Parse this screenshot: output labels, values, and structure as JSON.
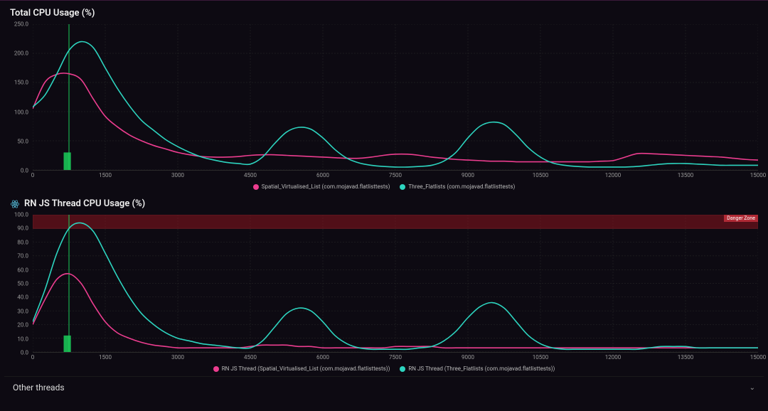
{
  "panels": {
    "total": {
      "title": "Total CPU Usage (%)"
    },
    "rnjs": {
      "title": "RN JS Thread CPU Usage (%)",
      "danger_label": "Danger Zone"
    },
    "other": {
      "title": "Other threads"
    }
  },
  "colors": {
    "series_a": "#ec3d8f",
    "series_b": "#2dd4bf",
    "danger_fill": "rgba(150,20,30,0.5)",
    "marker_green": "#1bcf5a"
  },
  "chart_data": [
    {
      "id": "total_cpu",
      "type": "line",
      "title": "Total CPU Usage (%)",
      "xlabel": "",
      "ylabel": "",
      "xlim": [
        0,
        15000
      ],
      "ylim": [
        0,
        250
      ],
      "x_ticks": [
        0,
        1500,
        3000,
        4500,
        6000,
        7500,
        9000,
        10500,
        12000,
        13500,
        15000
      ],
      "y_ticks": [
        0,
        50,
        100,
        150,
        200,
        250
      ],
      "y_tick_labels": [
        "0.0",
        "50.0",
        "100.0",
        "150.0",
        "200.0",
        "250.0"
      ],
      "x": [
        0,
        250,
        500,
        750,
        1000,
        1250,
        1500,
        1750,
        2000,
        2250,
        2500,
        2750,
        3000,
        3250,
        3500,
        3750,
        4000,
        4250,
        4500,
        4750,
        5000,
        5250,
        5500,
        5750,
        6000,
        6250,
        6500,
        6750,
        7000,
        7250,
        7500,
        7750,
        8000,
        8250,
        8500,
        8750,
        9000,
        9250,
        9500,
        9750,
        10000,
        10250,
        10500,
        10750,
        11000,
        11250,
        11500,
        11750,
        12000,
        12250,
        12500,
        12750,
        13000,
        13250,
        13500,
        13750,
        14000,
        14250,
        14500,
        14750,
        15000
      ],
      "series": [
        {
          "name": "Spatial_Virtualised_List (com.mojavad.flatlisttests)",
          "color": "#ec3d8f",
          "values": [
            105,
            150,
            164,
            165,
            155,
            122,
            92,
            74,
            60,
            50,
            42,
            36,
            30,
            26,
            23,
            22,
            22,
            23,
            25,
            26,
            26,
            25,
            24,
            23,
            22,
            21,
            20,
            20,
            22,
            25,
            27,
            27,
            25,
            22,
            20,
            18,
            17,
            16,
            15,
            15,
            14,
            14,
            14,
            14,
            14,
            14,
            14,
            15,
            16,
            22,
            28,
            28,
            27,
            26,
            25,
            24,
            23,
            22,
            20,
            18,
            17
          ]
        },
        {
          "name": "Three_Flatlists (com.mojavad.flatlisttests)",
          "color": "#2dd4bf",
          "values": [
            108,
            128,
            165,
            205,
            220,
            210,
            175,
            140,
            110,
            85,
            68,
            52,
            40,
            30,
            22,
            17,
            13,
            11,
            10,
            22,
            45,
            65,
            73,
            70,
            55,
            35,
            20,
            12,
            8,
            6,
            5,
            5,
            6,
            8,
            15,
            30,
            55,
            75,
            82,
            78,
            60,
            38,
            22,
            12,
            8,
            6,
            5,
            5,
            5,
            5,
            6,
            8,
            10,
            11,
            11,
            10,
            9,
            8,
            8,
            8,
            8
          ]
        }
      ],
      "marker": {
        "x_line": 750,
        "bar_x": 700,
        "bar_range": [
          0,
          30
        ]
      }
    },
    {
      "id": "rn_js_thread",
      "type": "line",
      "title": "RN JS Thread CPU Usage (%)",
      "xlabel": "",
      "ylabel": "",
      "xlim": [
        0,
        15000
      ],
      "ylim": [
        0,
        100
      ],
      "x_ticks": [
        0,
        1500,
        3000,
        4500,
        6000,
        7500,
        9000,
        10500,
        12000,
        13500,
        15000
      ],
      "y_ticks": [
        0,
        10,
        20,
        30,
        40,
        50,
        60,
        70,
        80,
        90,
        100
      ],
      "y_tick_labels": [
        "0.0",
        "10.0",
        "20.0",
        "30.0",
        "40.0",
        "50.0",
        "60.0",
        "70.0",
        "80.0",
        "90.0",
        "100.0"
      ],
      "danger_zone": {
        "y_from": 90,
        "y_to": 100
      },
      "x": [
        0,
        250,
        500,
        750,
        1000,
        1250,
        1500,
        1750,
        2000,
        2250,
        2500,
        2750,
        3000,
        3250,
        3500,
        3750,
        4000,
        4250,
        4500,
        4750,
        5000,
        5250,
        5500,
        5750,
        6000,
        6250,
        6500,
        6750,
        7000,
        7250,
        7500,
        7750,
        8000,
        8250,
        8500,
        8750,
        9000,
        9250,
        9500,
        9750,
        10000,
        10250,
        10500,
        10750,
        11000,
        11250,
        11500,
        11750,
        12000,
        12250,
        12500,
        12750,
        13000,
        13250,
        13500,
        13750,
        14000,
        14250,
        14500,
        14750,
        15000
      ],
      "series": [
        {
          "name": "RN JS Thread (Spatial_Virtualised_List (com.mojavad.flatlisttests))",
          "color": "#ec3d8f",
          "values": [
            20,
            38,
            53,
            57,
            50,
            35,
            22,
            14,
            10,
            7,
            5,
            4,
            3,
            3,
            3,
            3,
            3,
            3,
            4,
            5,
            5,
            5,
            4,
            4,
            3,
            3,
            3,
            3,
            3,
            3,
            4,
            4,
            4,
            4,
            3,
            3,
            3,
            3,
            3,
            3,
            3,
            3,
            3,
            3,
            3,
            3,
            3,
            3,
            3,
            3,
            3,
            3,
            3,
            3,
            3,
            3,
            3,
            3,
            3,
            3,
            3
          ]
        },
        {
          "name": "RN JS Thread (Three_Flatlists (com.mojavad.flatlisttests))",
          "color": "#2dd4bf",
          "values": [
            22,
            45,
            72,
            90,
            94,
            88,
            72,
            55,
            40,
            28,
            20,
            14,
            10,
            8,
            6,
            5,
            4,
            3,
            3,
            8,
            18,
            28,
            32,
            30,
            22,
            12,
            6,
            3,
            2,
            2,
            2,
            2,
            3,
            4,
            8,
            15,
            25,
            33,
            36,
            32,
            22,
            12,
            6,
            3,
            2,
            2,
            2,
            2,
            2,
            2,
            2,
            3,
            4,
            4,
            4,
            3,
            3,
            3,
            3,
            3,
            3
          ]
        }
      ],
      "marker": {
        "x_line": 750,
        "bar_x": 700,
        "bar_range": [
          0,
          12
        ]
      }
    }
  ]
}
